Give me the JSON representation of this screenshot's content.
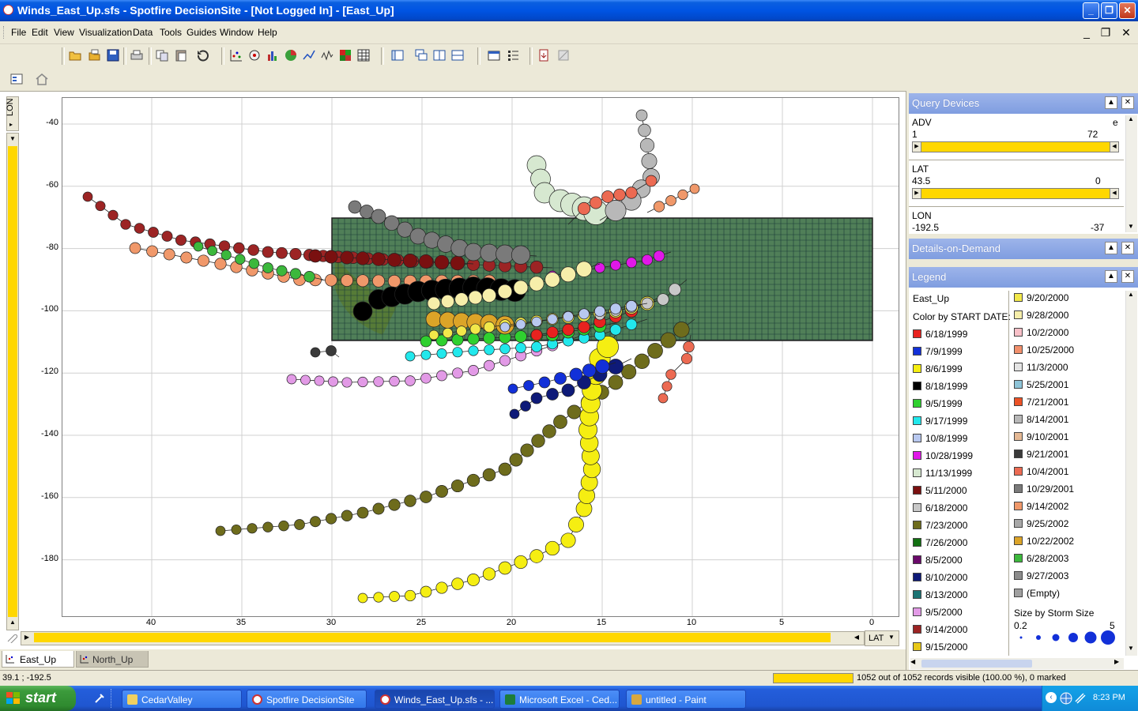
{
  "window": {
    "title": "Winds_East_Up.sfs - Spotfire DecisionSite - [Not Logged In] - [East_Up]"
  },
  "menu": [
    "File",
    "Edit",
    "View",
    "Visualization",
    "Data",
    "Tools",
    "Guides",
    "Window",
    "Help"
  ],
  "plot": {
    "y_axis_name": "LON",
    "x_axis_name": "LAT",
    "y_ticks": [
      "-40",
      "-60",
      "-80",
      "-100",
      "-120",
      "-140",
      "-160",
      "-180"
    ],
    "x_ticks": [
      "40",
      "35",
      "30",
      "25",
      "20",
      "15",
      "10",
      "5",
      "0"
    ]
  },
  "query_devices": {
    "title": "Query Devices",
    "adv": {
      "label": "ADV",
      "extra": "e",
      "min": "1",
      "max": "72"
    },
    "lat": {
      "label": "LAT",
      "min": "43.5",
      "max": "0"
    },
    "lon": {
      "label": "LON",
      "min": "-192.5",
      "max": "-37"
    }
  },
  "details": {
    "title": "Details-on-Demand"
  },
  "legend": {
    "title": "Legend",
    "viz_name": "East_Up",
    "color_by": "Color by START DATE:",
    "col1": [
      {
        "label": "6/18/1999",
        "color": "#e8221f"
      },
      {
        "label": "7/9/1999",
        "color": "#1230d8"
      },
      {
        "label": "8/6/1999",
        "color": "#f5ee12"
      },
      {
        "label": "8/18/1999",
        "color": "#000000"
      },
      {
        "label": "9/5/1999",
        "color": "#2fd02f"
      },
      {
        "label": "9/17/1999",
        "color": "#22e8ec"
      },
      {
        "label": "10/8/1999",
        "color": "#b8c8f0"
      },
      {
        "label": "10/28/1999",
        "color": "#e018e8"
      },
      {
        "label": "11/13/1999",
        "color": "#d6e8d0"
      },
      {
        "label": "5/11/2000",
        "color": "#7a1010"
      },
      {
        "label": "6/18/2000",
        "color": "#c8c8c8"
      },
      {
        "label": "7/23/2000",
        "color": "#6e6c1c"
      },
      {
        "label": "7/26/2000",
        "color": "#127012"
      },
      {
        "label": "8/5/2000",
        "color": "#6a0a6a"
      },
      {
        "label": "8/10/2000",
        "color": "#0e1a78"
      },
      {
        "label": "8/13/2000",
        "color": "#1c7474"
      },
      {
        "label": "9/5/2000",
        "color": "#e29ae6"
      },
      {
        "label": "9/14/2000",
        "color": "#9c2424"
      },
      {
        "label": "9/15/2000",
        "color": "#e8c818"
      }
    ],
    "col2": [
      {
        "label": "9/20/2000",
        "color": "#f2e84a"
      },
      {
        "label": "9/28/2000",
        "color": "#f6eeaa"
      },
      {
        "label": "10/2/2000",
        "color": "#f8c0c8"
      },
      {
        "label": "10/25/2000",
        "color": "#f2906c"
      },
      {
        "label": "11/3/2000",
        "color": "#e4e4e4"
      },
      {
        "label": "5/25/2001",
        "color": "#8ec4d8"
      },
      {
        "label": "7/21/2001",
        "color": "#ec5226"
      },
      {
        "label": "8/14/2001",
        "color": "#b8b8b8"
      },
      {
        "label": "9/10/2001",
        "color": "#e4b894"
      },
      {
        "label": "9/21/2001",
        "color": "#3a3a3a"
      },
      {
        "label": "10/4/2001",
        "color": "#ec6a52"
      },
      {
        "label": "10/29/2001",
        "color": "#7a7a7a"
      },
      {
        "label": "9/14/2002",
        "color": "#f0986a"
      },
      {
        "label": "9/25/2002",
        "color": "#a8a8a8"
      },
      {
        "label": "10/22/2002",
        "color": "#dca428"
      },
      {
        "label": "6/28/2003",
        "color": "#3cb83c"
      },
      {
        "label": "9/27/2003",
        "color": "#8c8c8c"
      },
      {
        "label": "(Empty)",
        "color": "#a0a0a0"
      }
    ],
    "size_by": "Size by Storm Size",
    "size_min": "0.2",
    "size_max": "5"
  },
  "tabs": [
    "East_Up",
    "North_Up"
  ],
  "status": {
    "coords": "39.1 ; -192.5",
    "records": "1052 out of 1052 records visible (100.00 %), 0 marked"
  },
  "taskbar": {
    "start": "start",
    "tasks": [
      "CedarValley",
      "Spotfire DecisionSite",
      "Winds_East_Up.sfs - ...",
      "Microsoft Excel - Ced...",
      "untitled - Paint"
    ],
    "clock": "8:23 PM"
  },
  "accent": {
    "slider": "#ffd700",
    "panel_header": "#8aa6e4"
  }
}
